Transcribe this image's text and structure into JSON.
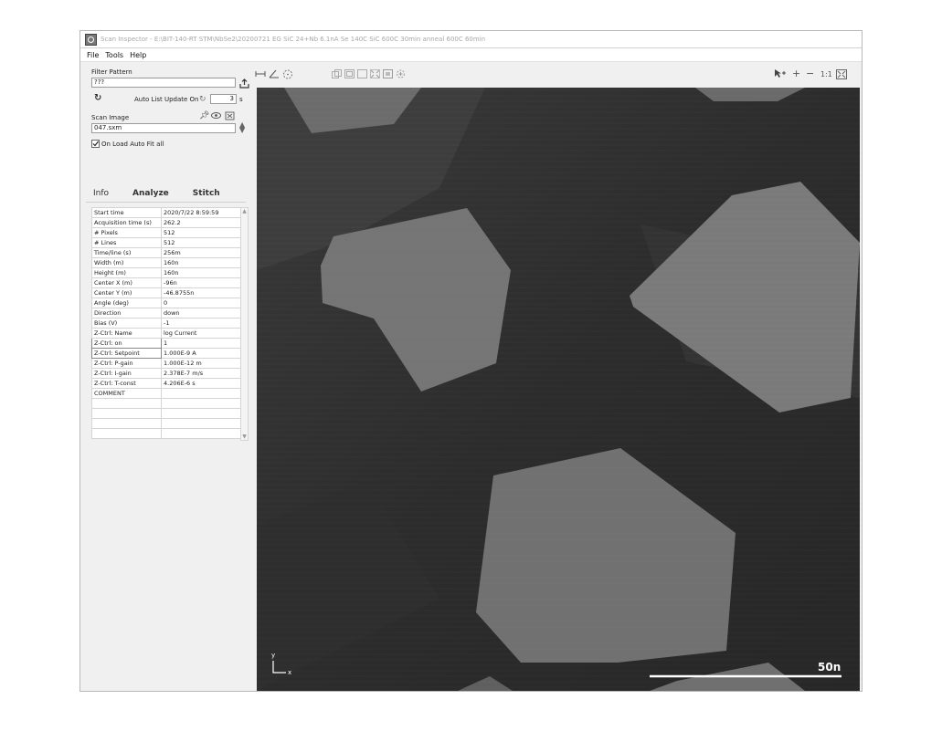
{
  "window": {
    "title": "Scan Inspector - E:\\BIT-140-RT STM\\NbSe2\\20200721 EG SiC 24+Nb 6.1nA Se 140C SiC 600C 30min anneal 600C 60min"
  },
  "menu": [
    "File",
    "Tools",
    "Help"
  ],
  "sidebar": {
    "filter_label": "Filter Pattern",
    "filter_value": "???",
    "auto_update_label": "Auto List Update On",
    "auto_update_value": "3",
    "auto_update_unit": "s",
    "scan_image_label": "Scan Image",
    "scan_image_value": "047.sxm",
    "autofit_label": "On Load Auto Fit all",
    "autofit_checked": true,
    "tabs": [
      "Info",
      "Analyze",
      "Stitch"
    ],
    "info_rows": [
      {
        "key": "Start time",
        "value": "2020/7/22 8:59:59"
      },
      {
        "key": "Acquisition time (s)",
        "value": "262.2"
      },
      {
        "key": "# Pixels",
        "value": "512"
      },
      {
        "key": "# Lines",
        "value": "512"
      },
      {
        "key": "Time/line (s)",
        "value": "256m"
      },
      {
        "key": "Width (m)",
        "value": "160n"
      },
      {
        "key": "Height (m)",
        "value": "160n"
      },
      {
        "key": "Center X (m)",
        "value": "-96n"
      },
      {
        "key": "Center Y (m)",
        "value": "-46.8755n"
      },
      {
        "key": "Angle (deg)",
        "value": "0"
      },
      {
        "key": "Direction",
        "value": "down"
      },
      {
        "key": "Bias (V)",
        "value": "-1"
      },
      {
        "key": "Z-Ctrl: Name",
        "value": "log Current"
      },
      {
        "key": "Z-Ctrl: on",
        "value": "1"
      },
      {
        "key": "Z-Ctrl: Setpoint",
        "value": "1.000E-9 A"
      },
      {
        "key": "Z-Ctrl: P-gain",
        "value": "1.000E-12 m"
      },
      {
        "key": "Z-Ctrl: I-gain",
        "value": "2.378E-7 m/s"
      },
      {
        "key": "Z-Ctrl: T-const",
        "value": "4.206E-6 s"
      },
      {
        "key": "COMMENT",
        "value": ""
      },
      {
        "key": "",
        "value": ""
      },
      {
        "key": "",
        "value": ""
      },
      {
        "key": "",
        "value": ""
      },
      {
        "key": "",
        "value": ""
      }
    ]
  },
  "toolbar": {
    "zoom_label": "1:1",
    "plus": "+",
    "minus": "−"
  },
  "image": {
    "scalebar_label": "50n",
    "axis_y": "y",
    "axis_x": "x"
  },
  "icons": [
    "refresh-icon",
    "export-icon",
    "pin-icon",
    "eye-icon",
    "fit-icon",
    "spin-icon",
    "measure-icon",
    "angle-icon",
    "region-icon",
    "cursor-icon",
    "zoom-fit-icon"
  ]
}
